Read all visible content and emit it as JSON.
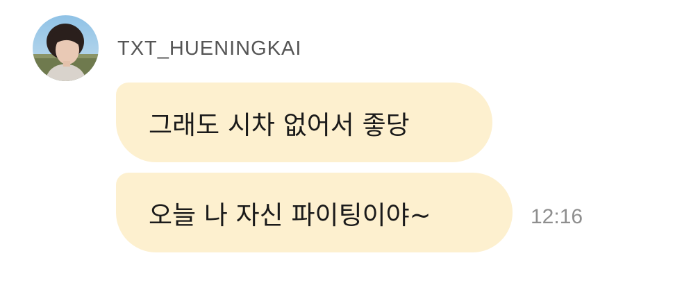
{
  "chat": {
    "sender_name": "TXT_HUENINGKAI",
    "avatar_icon": "profile-photo-avatar",
    "bubble_color": "#fdf0cf",
    "messages": [
      {
        "text": "그래도 시차 없어서 좋당"
      },
      {
        "text": "오늘 나 자신 파이팅이야~",
        "time": "12:16"
      }
    ]
  }
}
